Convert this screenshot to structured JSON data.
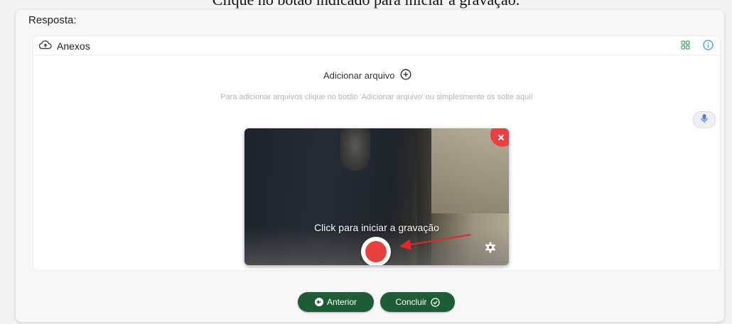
{
  "caption": "Clique no botão indicado para iniciar a gravação.",
  "form": {
    "resposta_label": "Resposta:"
  },
  "anexos": {
    "title": "Anexos",
    "add_file_label": "Adicionar arquivo",
    "hint": "Para adicionar arquivos clique no botão 'Adicionar arquivo' ou simplesmente os solte aqui!"
  },
  "recorder": {
    "start_label": "Click para iniciar a gravação"
  },
  "footer": {
    "prev_label": "Anterior",
    "done_label": "Concluir"
  },
  "colors": {
    "primary_green": "#1d5c34",
    "record_red": "#e8413c",
    "accent_green_icon": "#3aa35b",
    "info_blue": "#3a8fd6"
  },
  "icons": [
    "cloud-upload-icon",
    "grid-icon",
    "info-icon",
    "plus-circle-icon",
    "microphone-icon",
    "close-icon",
    "record-icon",
    "gear-icon",
    "arrow-left-icon",
    "check-circle-icon"
  ]
}
